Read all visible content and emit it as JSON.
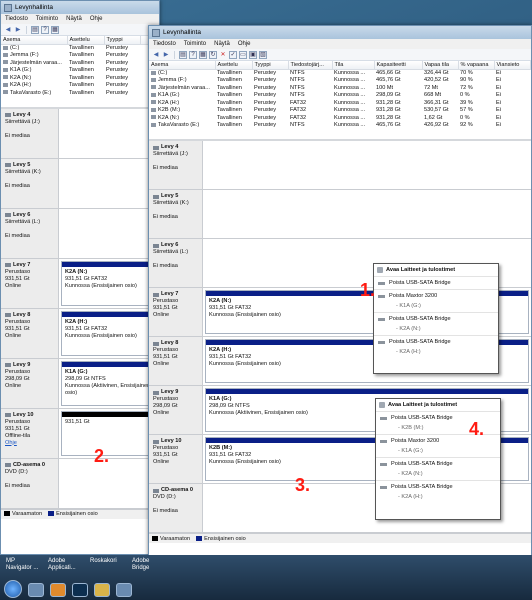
{
  "back_window": {
    "title": "Levynhallinta",
    "menu": [
      "Tiedosto",
      "Toiminto",
      "Näytä",
      "Ohje"
    ],
    "columns": [
      "Asema",
      "Asettelu",
      "Tyyppi"
    ],
    "volumes": [
      [
        "(C:)",
        "Tavallinen",
        "Perustey"
      ],
      [
        "Jemma (F:)",
        "Tavallinen",
        "Perustey"
      ],
      [
        "Järjestelmän varaa...",
        "Tavallinen",
        "Perustey"
      ],
      [
        "K1A (G:)",
        "Tavallinen",
        "Perustey"
      ],
      [
        "K2A (N:)",
        "Tavallinen",
        "Perustey"
      ],
      [
        "K2A (H:)",
        "Tavallinen",
        "Perustey"
      ],
      [
        "TakaVarasto (E:)",
        "Tavallinen",
        "Perustey"
      ]
    ],
    "disks": [
      {
        "name": "Levy 4",
        "lines": [
          "Siirrettävä (J:)",
          "",
          "Ei mediaa"
        ],
        "part": null
      },
      {
        "name": "Levy 5",
        "lines": [
          "Siirrettävä (K:)",
          "",
          "Ei mediaa"
        ],
        "part": null
      },
      {
        "name": "Levy 6",
        "lines": [
          "Siirrettävä (L:)",
          "",
          "Ei mediaa"
        ],
        "part": null
      },
      {
        "name": "Levy 7",
        "lines": [
          "Perustaso",
          "931,51 Gt",
          "Online"
        ],
        "part": {
          "title": "K2A (N:)",
          "l1": "931,51 Gt FAT32",
          "l2": "Kunnossa (Ensisijainen osio)"
        }
      },
      {
        "name": "Levy 8",
        "lines": [
          "Perustaso",
          "931,51 Gt",
          "Online"
        ],
        "part": {
          "title": "K2A (H:)",
          "l1": "931,51 Gt FAT32",
          "l2": "Kunnossa (Ensisijainen osio)"
        }
      },
      {
        "name": "Levy 9",
        "lines": [
          "Perustaso",
          "298,09 Gt",
          "Online"
        ],
        "part": {
          "title": "K1A (G:)",
          "l1": "298,09 Gt NTFS",
          "l2": "Kunnossa (Aktiivinen, Ensisijainen osio)"
        }
      },
      {
        "name": "Levy 10",
        "lines": [
          "Perustaso",
          "931,51 Gt",
          "Offline-tila"
        ],
        "link": "Ohje",
        "part": {
          "title": "",
          "l1": "931,51 Gt",
          "l2": ""
        },
        "unalloc": true
      },
      {
        "name": "CD-asema 0",
        "lines": [
          "DVD (D:)",
          "",
          "Ei mediaa"
        ],
        "part": null
      }
    ],
    "legend": [
      "Varaamaton",
      "Ensisijainen osio"
    ]
  },
  "front_window": {
    "title": "Levynhallinta",
    "menu": [
      "Tiedosto",
      "Toiminto",
      "Näytä",
      "Ohje"
    ],
    "columns": [
      "Asema",
      "Asettelu",
      "Tyyppi",
      "Tiedostojärj...",
      "Tila",
      "Kapasiteetti",
      "Vapaa tila",
      "% vapaana",
      "Viansieto"
    ],
    "volumes": [
      [
        "(C:)",
        "Tavallinen",
        "Perustey",
        "NTFS",
        "Kunnossa ...",
        "465,66 Gt",
        "326,44 Gt",
        "70 %",
        "Ei"
      ],
      [
        "Jemma (F:)",
        "Tavallinen",
        "Perustey",
        "NTFS",
        "Kunnossa ...",
        "465,76 Gt",
        "420,52 Gt",
        "90 %",
        "Ei"
      ],
      [
        "Järjestelmän varaa...",
        "Tavallinen",
        "Perustey",
        "NTFS",
        "Kunnossa ...",
        "100 Mt",
        "72 Mt",
        "72 %",
        "Ei"
      ],
      [
        "K1A (G:)",
        "Tavallinen",
        "Perustey",
        "NTFS",
        "Kunnossa ...",
        "298,09 Gt",
        "668 Mt",
        "0 %",
        "Ei"
      ],
      [
        "K2A (H:)",
        "Tavallinen",
        "Perustey",
        "FAT32",
        "Kunnossa ...",
        "931,28 Gt",
        "366,31 Gt",
        "39 %",
        "Ei"
      ],
      [
        "K2B (M:)",
        "Tavallinen",
        "Perustey",
        "FAT32",
        "Kunnossa ...",
        "931,28 Gt",
        "530,57 Gt",
        "57 %",
        "Ei"
      ],
      [
        "K2A (N:)",
        "Tavallinen",
        "Perustey",
        "FAT32",
        "Kunnossa ...",
        "931,28 Gt",
        "1,62 Gt",
        "0 %",
        "Ei"
      ],
      [
        "TakaVarasto (E:)",
        "Tavallinen",
        "Perustey",
        "NTFS",
        "Kunnossa ...",
        "465,76 Gt",
        "426,92 Gt",
        "92 %",
        "Ei"
      ]
    ],
    "disks": [
      {
        "name": "Levy 4",
        "lines": [
          "Siirrettävä (J:)",
          "",
          "Ei mediaa"
        ],
        "part": null
      },
      {
        "name": "Levy 5",
        "lines": [
          "Siirrettävä (K:)",
          "",
          "Ei mediaa"
        ],
        "part": null
      },
      {
        "name": "Levy 6",
        "lines": [
          "Siirrettävä (L:)",
          "",
          "Ei mediaa"
        ],
        "part": null
      },
      {
        "name": "Levy 7",
        "lines": [
          "Perustaso",
          "931,51 Gt",
          "Online"
        ],
        "part": {
          "title": "K2A (N:)",
          "l1": "931,51 Gt FAT32",
          "l2": "Kunnossa (Ensisijainen osio)"
        }
      },
      {
        "name": "Levy 8",
        "lines": [
          "Perustaso",
          "931,51 Gt",
          "Online"
        ],
        "part": {
          "title": "K2A (H:)",
          "l1": "931,51 Gt FAT32",
          "l2": "Kunnossa (Ensisijainen osio)"
        }
      },
      {
        "name": "Levy 9",
        "lines": [
          "Perustaso",
          "298,09 Gt",
          "Online"
        ],
        "part": {
          "title": "K1A (G:)",
          "l1": "298,09 Gt NTFS",
          "l2": "Kunnossa (Aktiivinen, Ensisijainen osio)"
        }
      },
      {
        "name": "Levy 10",
        "lines": [
          "Perustaso",
          "931,51 Gt",
          "Online"
        ],
        "part": {
          "title": "K2B (M:)",
          "l1": "931,51 Gt FAT32",
          "l2": "Kunnossa (Ensisijainen osio)"
        }
      },
      {
        "name": "CD-asema 0",
        "lines": [
          "DVD (D:)",
          "",
          "Ei mediaa"
        ],
        "part": null
      }
    ],
    "legend": [
      "Varaamaton",
      "Ensisijainen osio"
    ]
  },
  "popup1": {
    "header": "Avaa Laitteet ja tulostimet",
    "items": [
      {
        "label": "Poista USB-SATA Bridge",
        "sub": ""
      },
      {
        "label": "Poista Maxtor 3200",
        "sub": "- K1A (G:)"
      },
      {
        "label": "Poista USB-SATA Bridge",
        "sub": "- K2A (N:)"
      },
      {
        "label": "Poista USB-SATA Bridge",
        "sub": "- K2A (H:)"
      }
    ]
  },
  "popup2": {
    "header": "Avaa Laitteet ja tulostimet",
    "items": [
      {
        "label": "Poista USB-SATA Bridge",
        "sub": "- K2B (M:)"
      },
      {
        "label": "Poista Maxtor 3200",
        "sub": "- K1A (G:)"
      },
      {
        "label": "Poista USB-SATA Bridge",
        "sub": "- K2A (N:)"
      },
      {
        "label": "Poista USB-SATA Bridge",
        "sub": "- K2A (H:)"
      }
    ]
  },
  "markers": {
    "m1": "1.",
    "m2": "2.",
    "m3": "3.",
    "m4": "4."
  },
  "taskbar": {
    "apps": [
      "MP Navigator ...",
      "Adobe Applicati...",
      "Roskakori",
      "Adobe Bridge"
    ]
  },
  "colors": {
    "primary_partition": "#0a1f87",
    "unallocated": "#000000",
    "marker": "#ff1b12"
  }
}
